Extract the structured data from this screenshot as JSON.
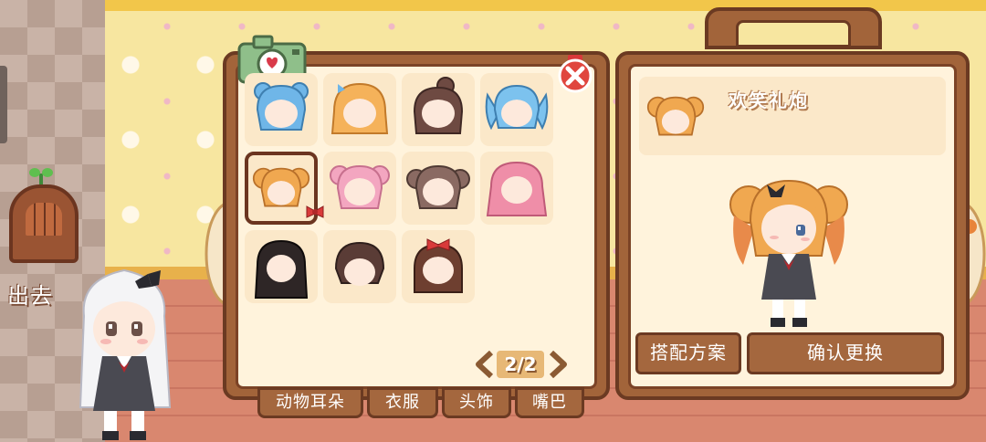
{
  "exit": {
    "label": "出去"
  },
  "wardrobe": {
    "hair_colors": [
      "#6fb6e8",
      "#f5b25a",
      "#6e4a42",
      "#7cc2ee",
      "#f0a850",
      "#f3a6c0",
      "#8a6a62",
      "#ef8ea8",
      "#2e2626",
      "#5a3c36",
      "#6e3f30"
    ],
    "selected_index": 4,
    "pager": {
      "text": "2/2"
    },
    "tabs": [
      "动物耳朵",
      "衣服",
      "头饰",
      "嘴巴"
    ]
  },
  "preview": {
    "item_name": "欢笑礼炮",
    "outfit_button": "搭配方案",
    "confirm_button": "确认更换"
  }
}
